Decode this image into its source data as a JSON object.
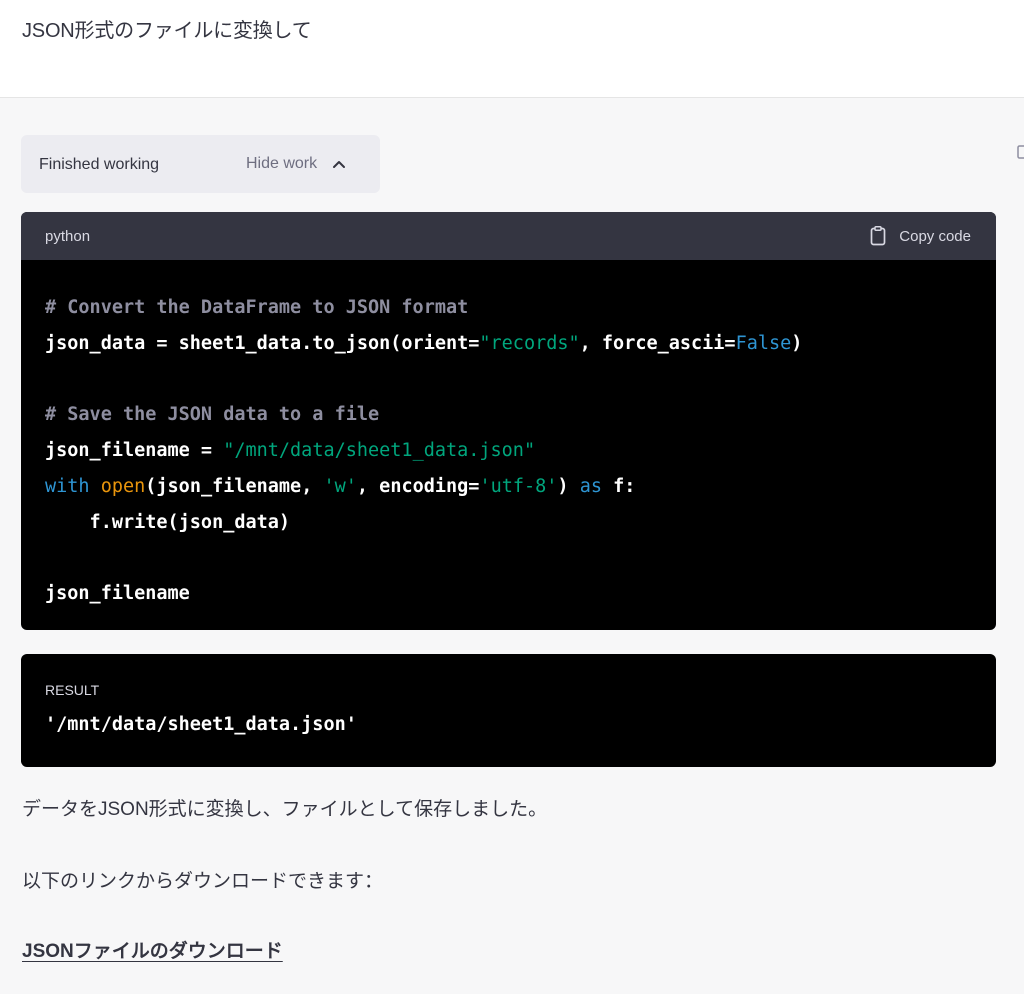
{
  "user_message": "JSON形式のファイルに変換して",
  "work_panel": {
    "status": "Finished working",
    "toggle_label": "Hide work"
  },
  "code_block": {
    "language": "python",
    "copy_label": "Copy code",
    "lines": [
      [
        {
          "t": "# Convert the DataFrame to JSON format",
          "c": "com"
        }
      ],
      [
        {
          "t": "json_data = sheet1_data.to_json(orient=",
          "c": ""
        },
        {
          "t": "\"records\"",
          "c": "str"
        },
        {
          "t": ", force_ascii=",
          "c": ""
        },
        {
          "t": "False",
          "c": "kw"
        },
        {
          "t": ")",
          "c": ""
        }
      ],
      [],
      [
        {
          "t": "# Save the JSON data to a file",
          "c": "com"
        }
      ],
      [
        {
          "t": "json_filename = ",
          "c": ""
        },
        {
          "t": "\"/mnt/data/sheet1_data.json\"",
          "c": "str"
        }
      ],
      [
        {
          "t": "with",
          "c": "kw"
        },
        {
          "t": " ",
          "c": ""
        },
        {
          "t": "open",
          "c": "bi"
        },
        {
          "t": "(json_filename, ",
          "c": ""
        },
        {
          "t": "'w'",
          "c": "str"
        },
        {
          "t": ", encoding=",
          "c": ""
        },
        {
          "t": "'utf-8'",
          "c": "str"
        },
        {
          "t": ") ",
          "c": ""
        },
        {
          "t": "as",
          "c": "kw"
        },
        {
          "t": " f:",
          "c": ""
        }
      ],
      [
        {
          "t": "    f.write(json_data)",
          "c": ""
        }
      ],
      [],
      [
        {
          "t": "json_filename",
          "c": ""
        }
      ]
    ]
  },
  "result_block": {
    "label": "RESULT",
    "value": "'/mnt/data/sheet1_data.json'"
  },
  "assistant": {
    "paragraph1": "データをJSON形式に変換し、ファイルとして保存しました。",
    "paragraph2": "以下のリンクからダウンロードできます：",
    "download_link": "JSONファイルのダウンロード"
  },
  "colors": {
    "code_comment": "#8e8ea0",
    "code_string": "#00a67d",
    "code_keyword": "#2e95d3",
    "code_builtin": "#e9950c"
  },
  "icons": {
    "toggle": "chevron-up-icon",
    "copy": "clipboard-icon",
    "edge": "clipboard-icon"
  }
}
